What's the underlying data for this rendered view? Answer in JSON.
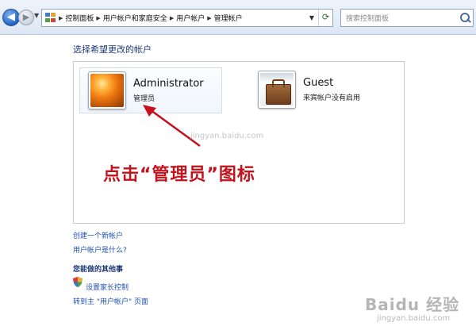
{
  "address_bar": {
    "breadcrumbs": [
      "控制面板",
      "用户帐户和家庭安全",
      "用户帐户",
      "管理帐户"
    ],
    "search_placeholder": "搜索控制面板"
  },
  "main": {
    "heading": "选择希望更改的帐户",
    "accounts": [
      {
        "name": "Administrator",
        "role": "管理员",
        "picture": "orange-flower-picture"
      },
      {
        "name": "Guest",
        "role": "来宾帐户没有启用",
        "picture": "briefcase-picture"
      }
    ],
    "links": [
      "创建一个新帐户",
      "用户帐户是什么?"
    ]
  },
  "other_tasks": {
    "title": "您能做的其他事",
    "items": [
      "设置家长控制",
      "转到主 \"用户帐户\" 页面"
    ]
  },
  "annotation": {
    "text": "点击“管理员”图标",
    "color": "#c3121c"
  },
  "watermark": {
    "brand": "Baidu 经验",
    "url": "jingyan.baidu.com",
    "sub": "jingyan.baidu.com"
  }
}
